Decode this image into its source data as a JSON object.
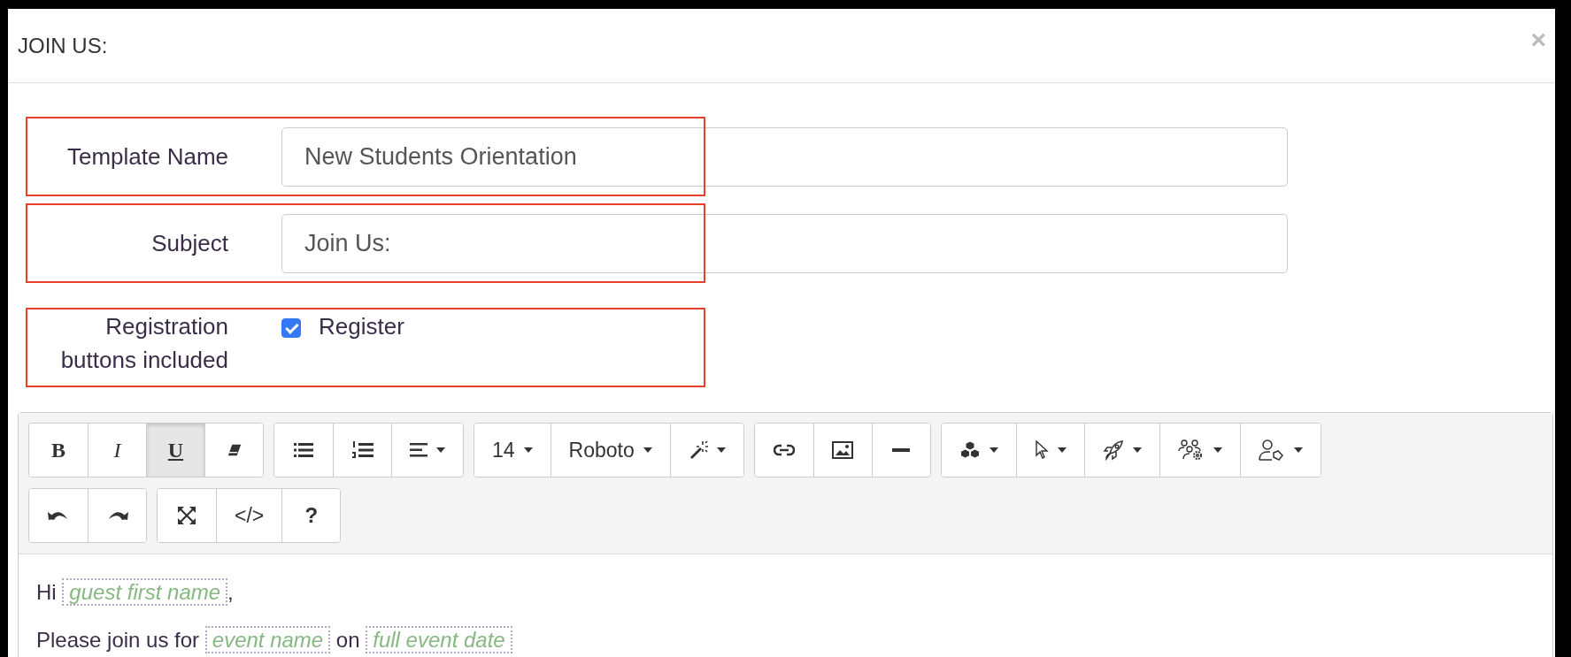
{
  "dialog": {
    "title": "JOIN US:",
    "close": "×"
  },
  "form": {
    "fields": [
      {
        "kind": "text",
        "label": "Template Name",
        "value": "New Students Orientation",
        "highlighted": true
      },
      {
        "kind": "text",
        "label": "Subject",
        "value": "Join Us:",
        "highlighted": true
      },
      {
        "kind": "checkbox",
        "label": "Registration buttons included",
        "option": "Register",
        "checked": true,
        "highlighted": true
      }
    ]
  },
  "toolbar": {
    "rows": [
      [
        [
          {
            "kind": "bold",
            "text": "B",
            "selected": false
          },
          {
            "kind": "italic",
            "text": "I",
            "selected": false
          },
          {
            "kind": "underline",
            "text": "U",
            "selected": true
          },
          {
            "kind": "eraser",
            "selected": false
          }
        ],
        [
          {
            "kind": "bullet-list",
            "selected": false
          },
          {
            "kind": "numbered-list",
            "selected": false
          },
          {
            "kind": "align",
            "dropdown": true,
            "selected": false
          }
        ],
        [
          {
            "kind": "label",
            "text": "14",
            "dropdown": true,
            "selected": false
          },
          {
            "kind": "label",
            "text": "Roboto",
            "dropdown": true,
            "selected": false
          },
          {
            "kind": "wand",
            "dropdown": true,
            "selected": false
          }
        ],
        [
          {
            "kind": "link",
            "selected": false
          },
          {
            "kind": "image",
            "selected": false
          },
          {
            "kind": "rule",
            "selected": false
          }
        ],
        [
          {
            "kind": "cubes",
            "dropdown": true,
            "selected": false
          },
          {
            "kind": "cursor",
            "dropdown": true,
            "selected": false
          },
          {
            "kind": "rocket",
            "dropdown": true,
            "selected": false
          },
          {
            "kind": "people-gear",
            "dropdown": true,
            "selected": false
          },
          {
            "kind": "person-tag",
            "dropdown": true,
            "selected": false
          }
        ]
      ],
      [
        [
          {
            "kind": "undo",
            "selected": false
          },
          {
            "kind": "redo",
            "selected": false
          }
        ],
        [
          {
            "kind": "expand",
            "selected": false
          },
          {
            "kind": "label",
            "text": "</>",
            "selected": false
          },
          {
            "kind": "help",
            "text": "?",
            "selected": false
          }
        ]
      ]
    ]
  },
  "body": {
    "paragraphs": [
      [
        {
          "kind": "text",
          "text": "Hi "
        },
        {
          "kind": "merge-tag",
          "text": "guest first name"
        },
        {
          "kind": "text",
          "text": ","
        }
      ],
      [
        {
          "kind": "text",
          "text": "Please join us for "
        },
        {
          "kind": "merge-tag",
          "text": "event name"
        },
        {
          "kind": "text",
          "text": " on "
        },
        {
          "kind": "merge-tag",
          "text": "full event date"
        }
      ]
    ]
  }
}
